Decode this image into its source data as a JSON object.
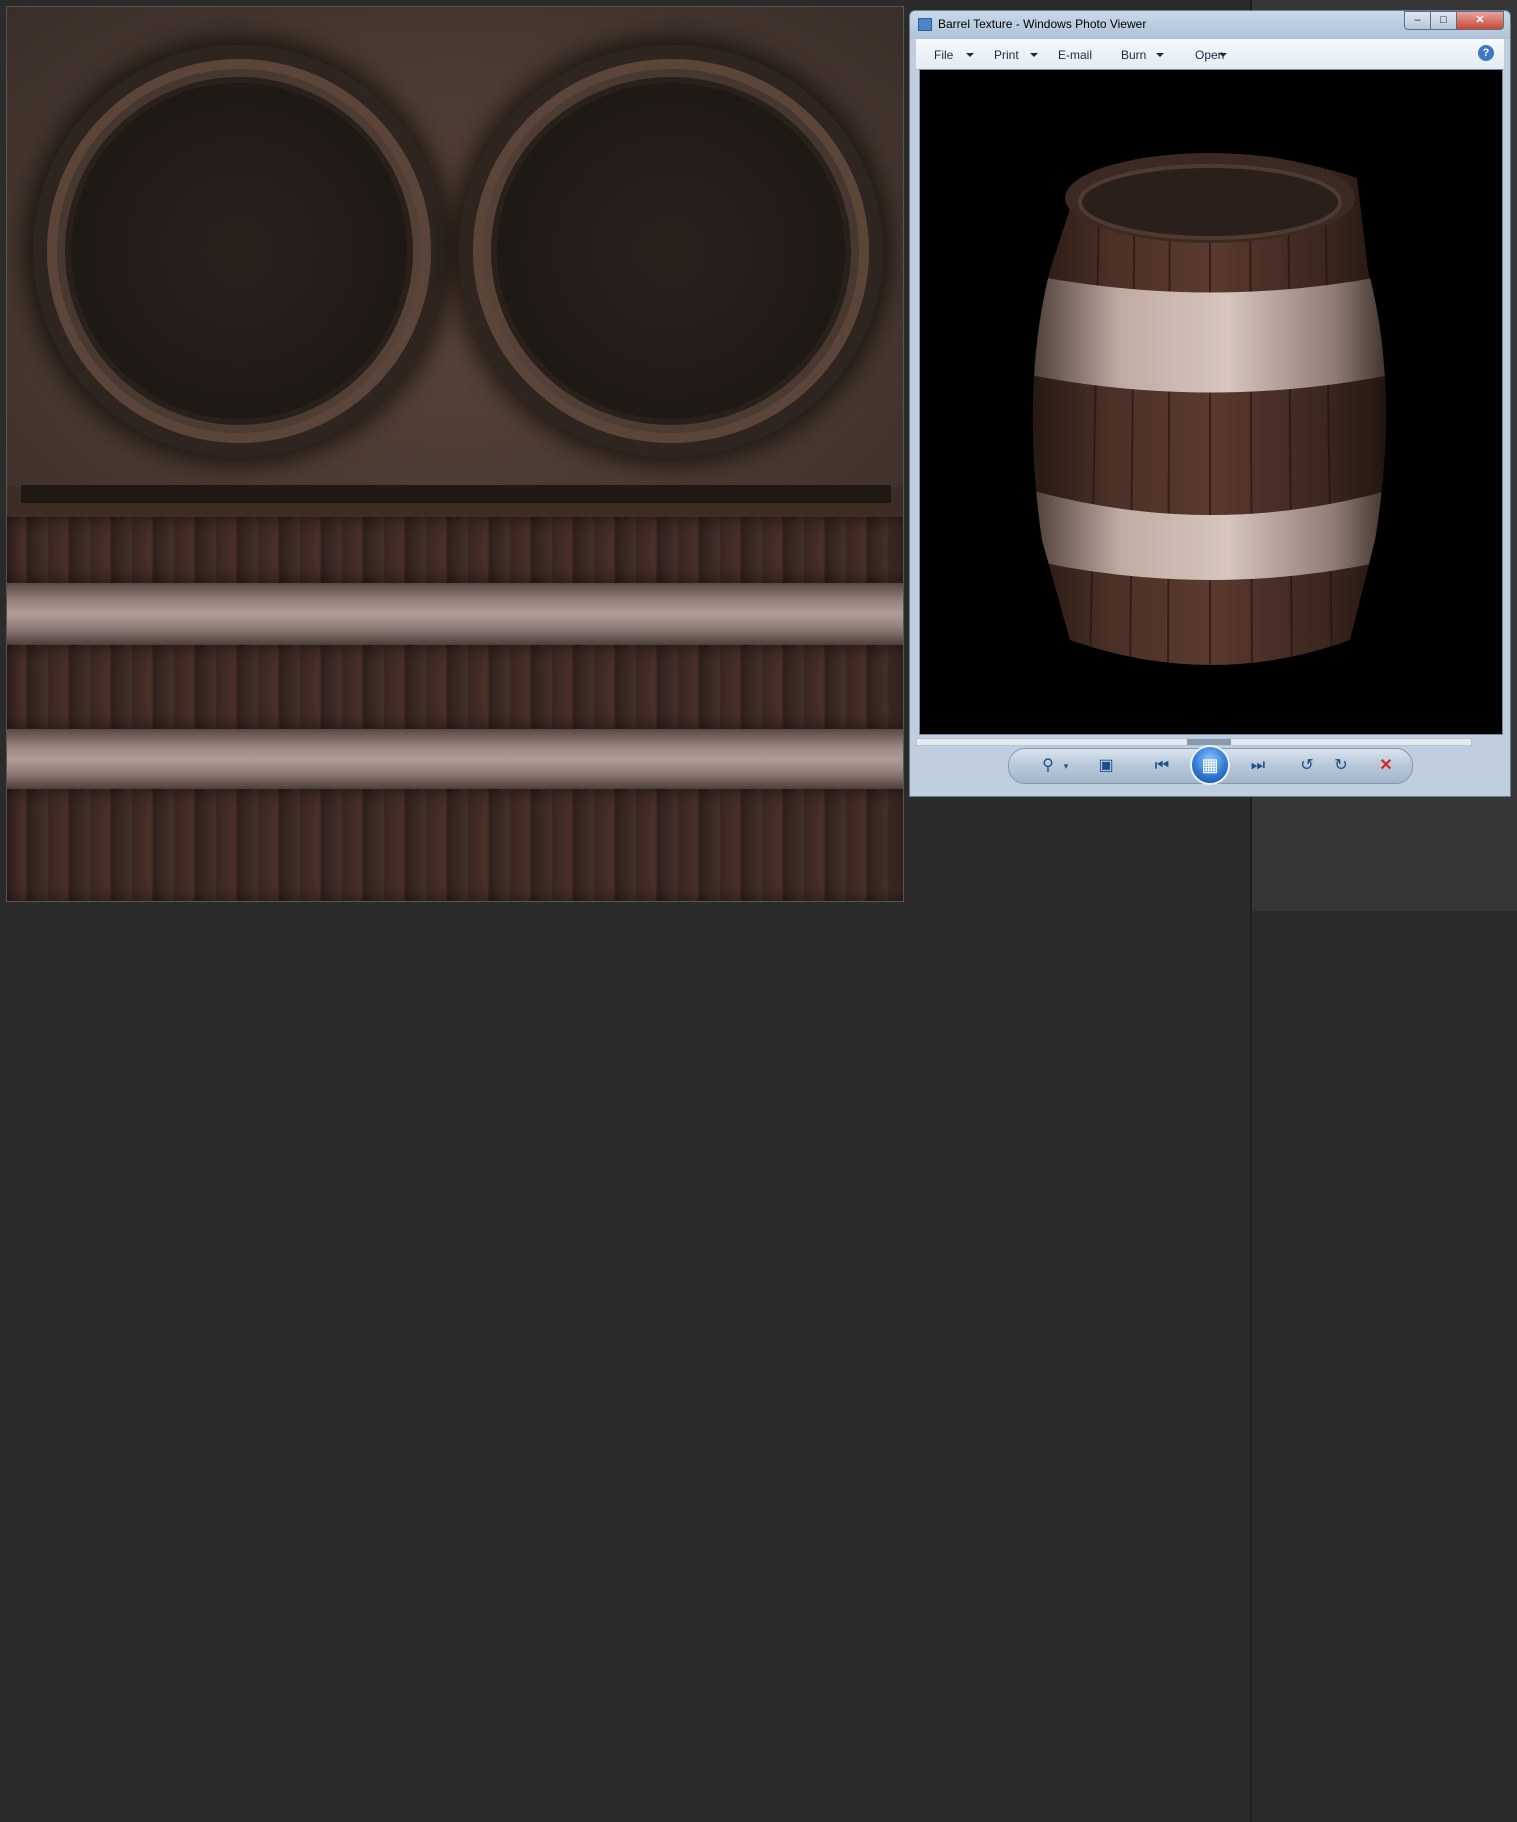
{
  "photo_viewer": {
    "title": "Barrel Texture - Windows Photo Viewer",
    "window_buttons": {
      "minimize": "–",
      "maximize": "□",
      "close": "✕"
    },
    "menu": [
      "File",
      "Print",
      "E-mail",
      "Burn",
      "Open"
    ],
    "help": "?",
    "controls": {
      "zoom_icon": "magnifier-icon",
      "actual_size_icon": "fit-window-icon",
      "previous_icon": "skip-back-icon",
      "slideshow_icon": "slideshow-icon",
      "next_icon": "skip-forward-icon",
      "rotate_left_icon": "rotate-ccw-icon",
      "rotate_right_icon": "rotate-cw-icon",
      "delete_icon": "delete-icon"
    },
    "accent_color": "#3f79c1"
  }
}
